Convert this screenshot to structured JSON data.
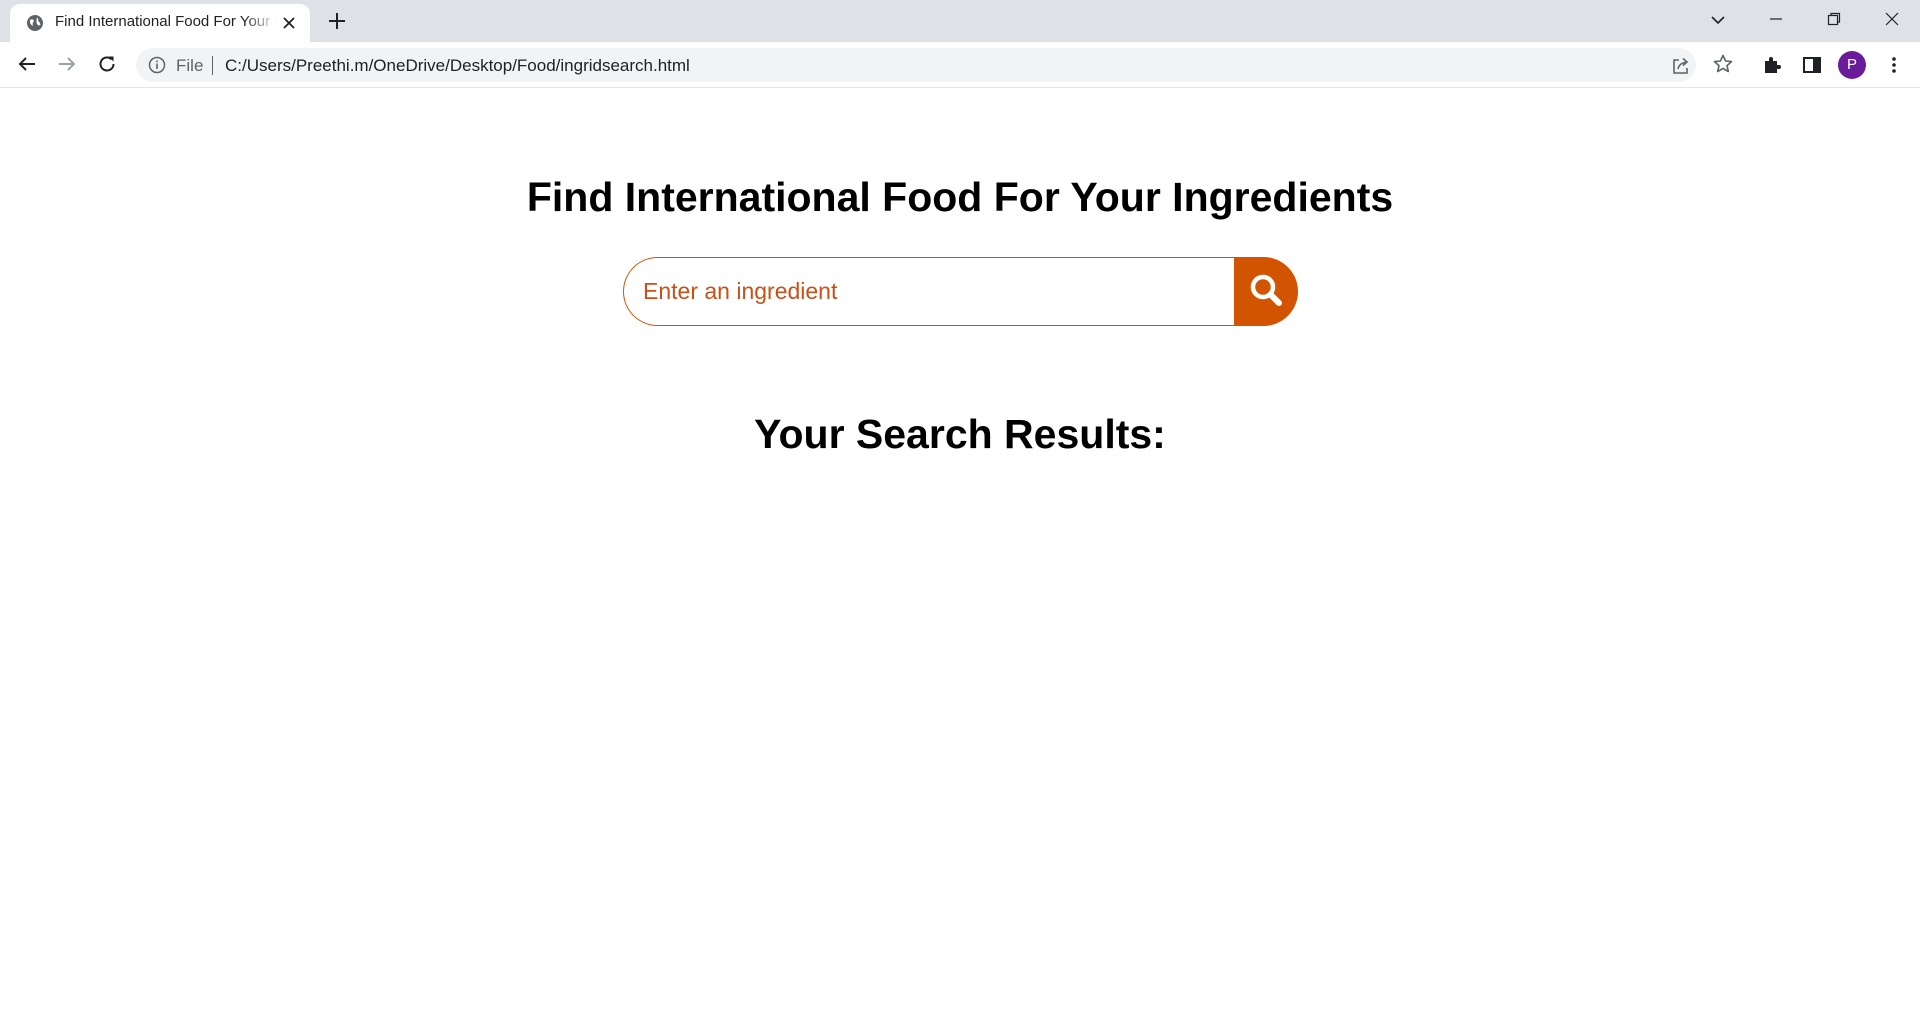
{
  "browser": {
    "tab": {
      "title": "Find International Food For Your Ingredients"
    },
    "address_bar": {
      "scheme_label": "File",
      "url": "C:/Users/Preethi.m/OneDrive/Desktop/Food/ingridsearch.html"
    },
    "profile_initial": "P",
    "profile_color": "#6a1b9a"
  },
  "page": {
    "title": "Find International Food For Your Ingredients",
    "search": {
      "placeholder": "Enter an ingredient",
      "value": ""
    },
    "results_heading": "Your Search Results:",
    "results": []
  },
  "colors": {
    "accent": "#d35400",
    "tabstrip": "#dee1e6",
    "omnibox": "#f1f3f4"
  }
}
